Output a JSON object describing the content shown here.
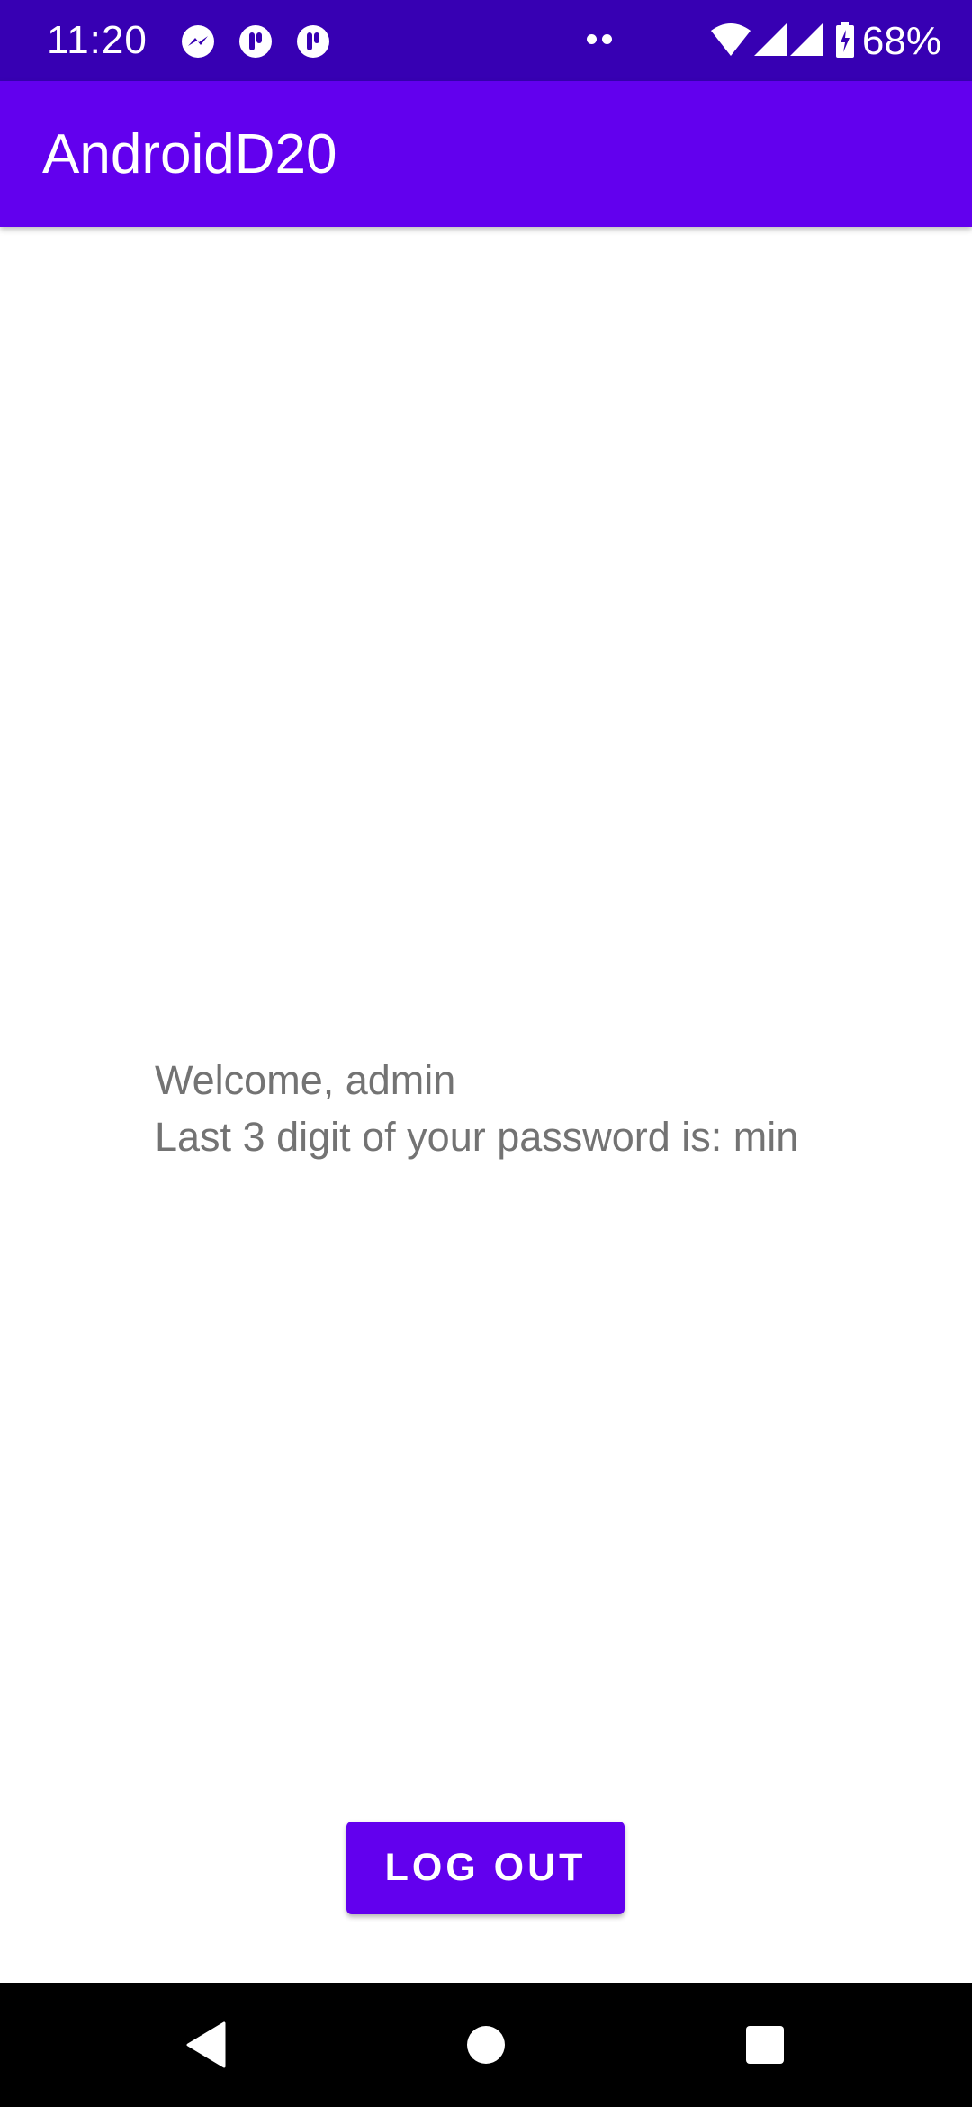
{
  "status_bar": {
    "time": "11:20",
    "battery": "68%",
    "notification_icons": [
      "messenger-icon",
      "notification-icon",
      "notification-icon"
    ],
    "system_icons": [
      "more-notifications-icon",
      "wifi-icon",
      "signal-icon",
      "signal-icon",
      "battery-charging-icon"
    ]
  },
  "app_bar": {
    "title": "AndroidD20"
  },
  "main": {
    "welcome_line": "Welcome, admin",
    "password_line": "Last 3 digit of your password is: min",
    "logout_label": "LOG OUT"
  },
  "nav_bar": {
    "buttons": [
      "back-icon",
      "home-icon",
      "recents-icon"
    ]
  },
  "colors": {
    "status_bar": "#3700b3",
    "primary": "#6200ee",
    "body_text": "#737373",
    "background": "#ffffff",
    "nav_bar": "#000000"
  }
}
